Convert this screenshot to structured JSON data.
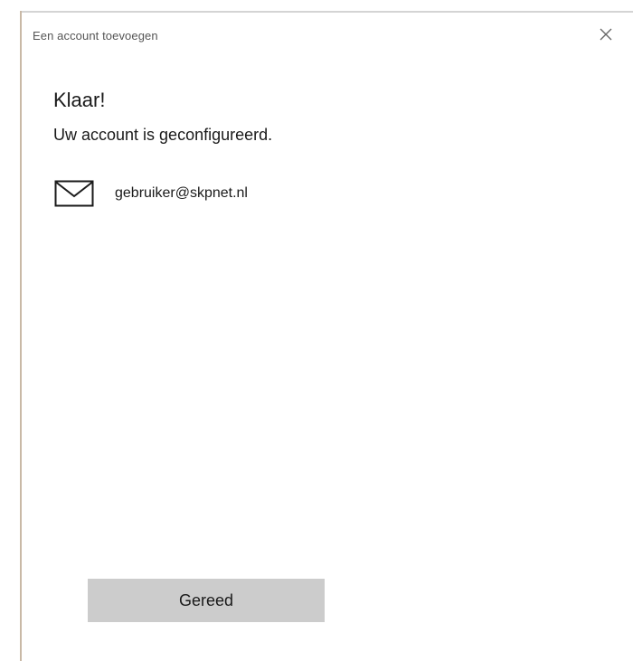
{
  "dialog": {
    "title": "Een account toevoegen",
    "close_icon": "close-icon"
  },
  "content": {
    "heading": "Klaar!",
    "subtext": "Uw account is geconfigureerd.",
    "account": {
      "icon": "mail-icon",
      "email": "gebruiker@skpnet.nl"
    }
  },
  "footer": {
    "done_label": "Gereed"
  },
  "colors": {
    "window_edge": "#c9b9a6",
    "button_bg": "#cccccc",
    "text": "#1a1a1a"
  }
}
